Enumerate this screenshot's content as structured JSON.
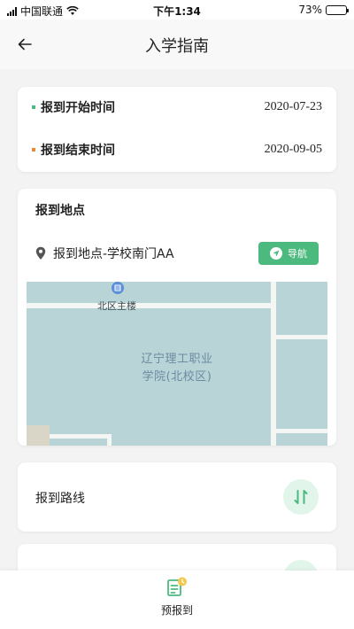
{
  "status_bar": {
    "carrier": "中国联通",
    "time": "下午1:34",
    "battery": "73%",
    "battery_level": 0.73
  },
  "nav": {
    "title": "入学指南"
  },
  "registration_time": {
    "start_label": "报到开始时间",
    "start_date": "2020-07-23",
    "start_color": "#4cb97e",
    "end_label": "报到结束时间",
    "end_date": "2020-09-05",
    "end_color": "#e68a3a"
  },
  "location": {
    "title": "报到地点",
    "address": "报到地点-学校南门AA",
    "navigate_label": "导航",
    "map": {
      "poi_label": "北区主楼",
      "campus_label_line1": "辽宁理工职业",
      "campus_label_line2": "学院(北校区)"
    }
  },
  "route": {
    "label": "报到路线"
  },
  "bottom_tab": {
    "label": "预报到"
  },
  "colors": {
    "accent": "#4cb97e",
    "accent_light": "#e2f5ea",
    "map_water": "#b8d4d6"
  }
}
